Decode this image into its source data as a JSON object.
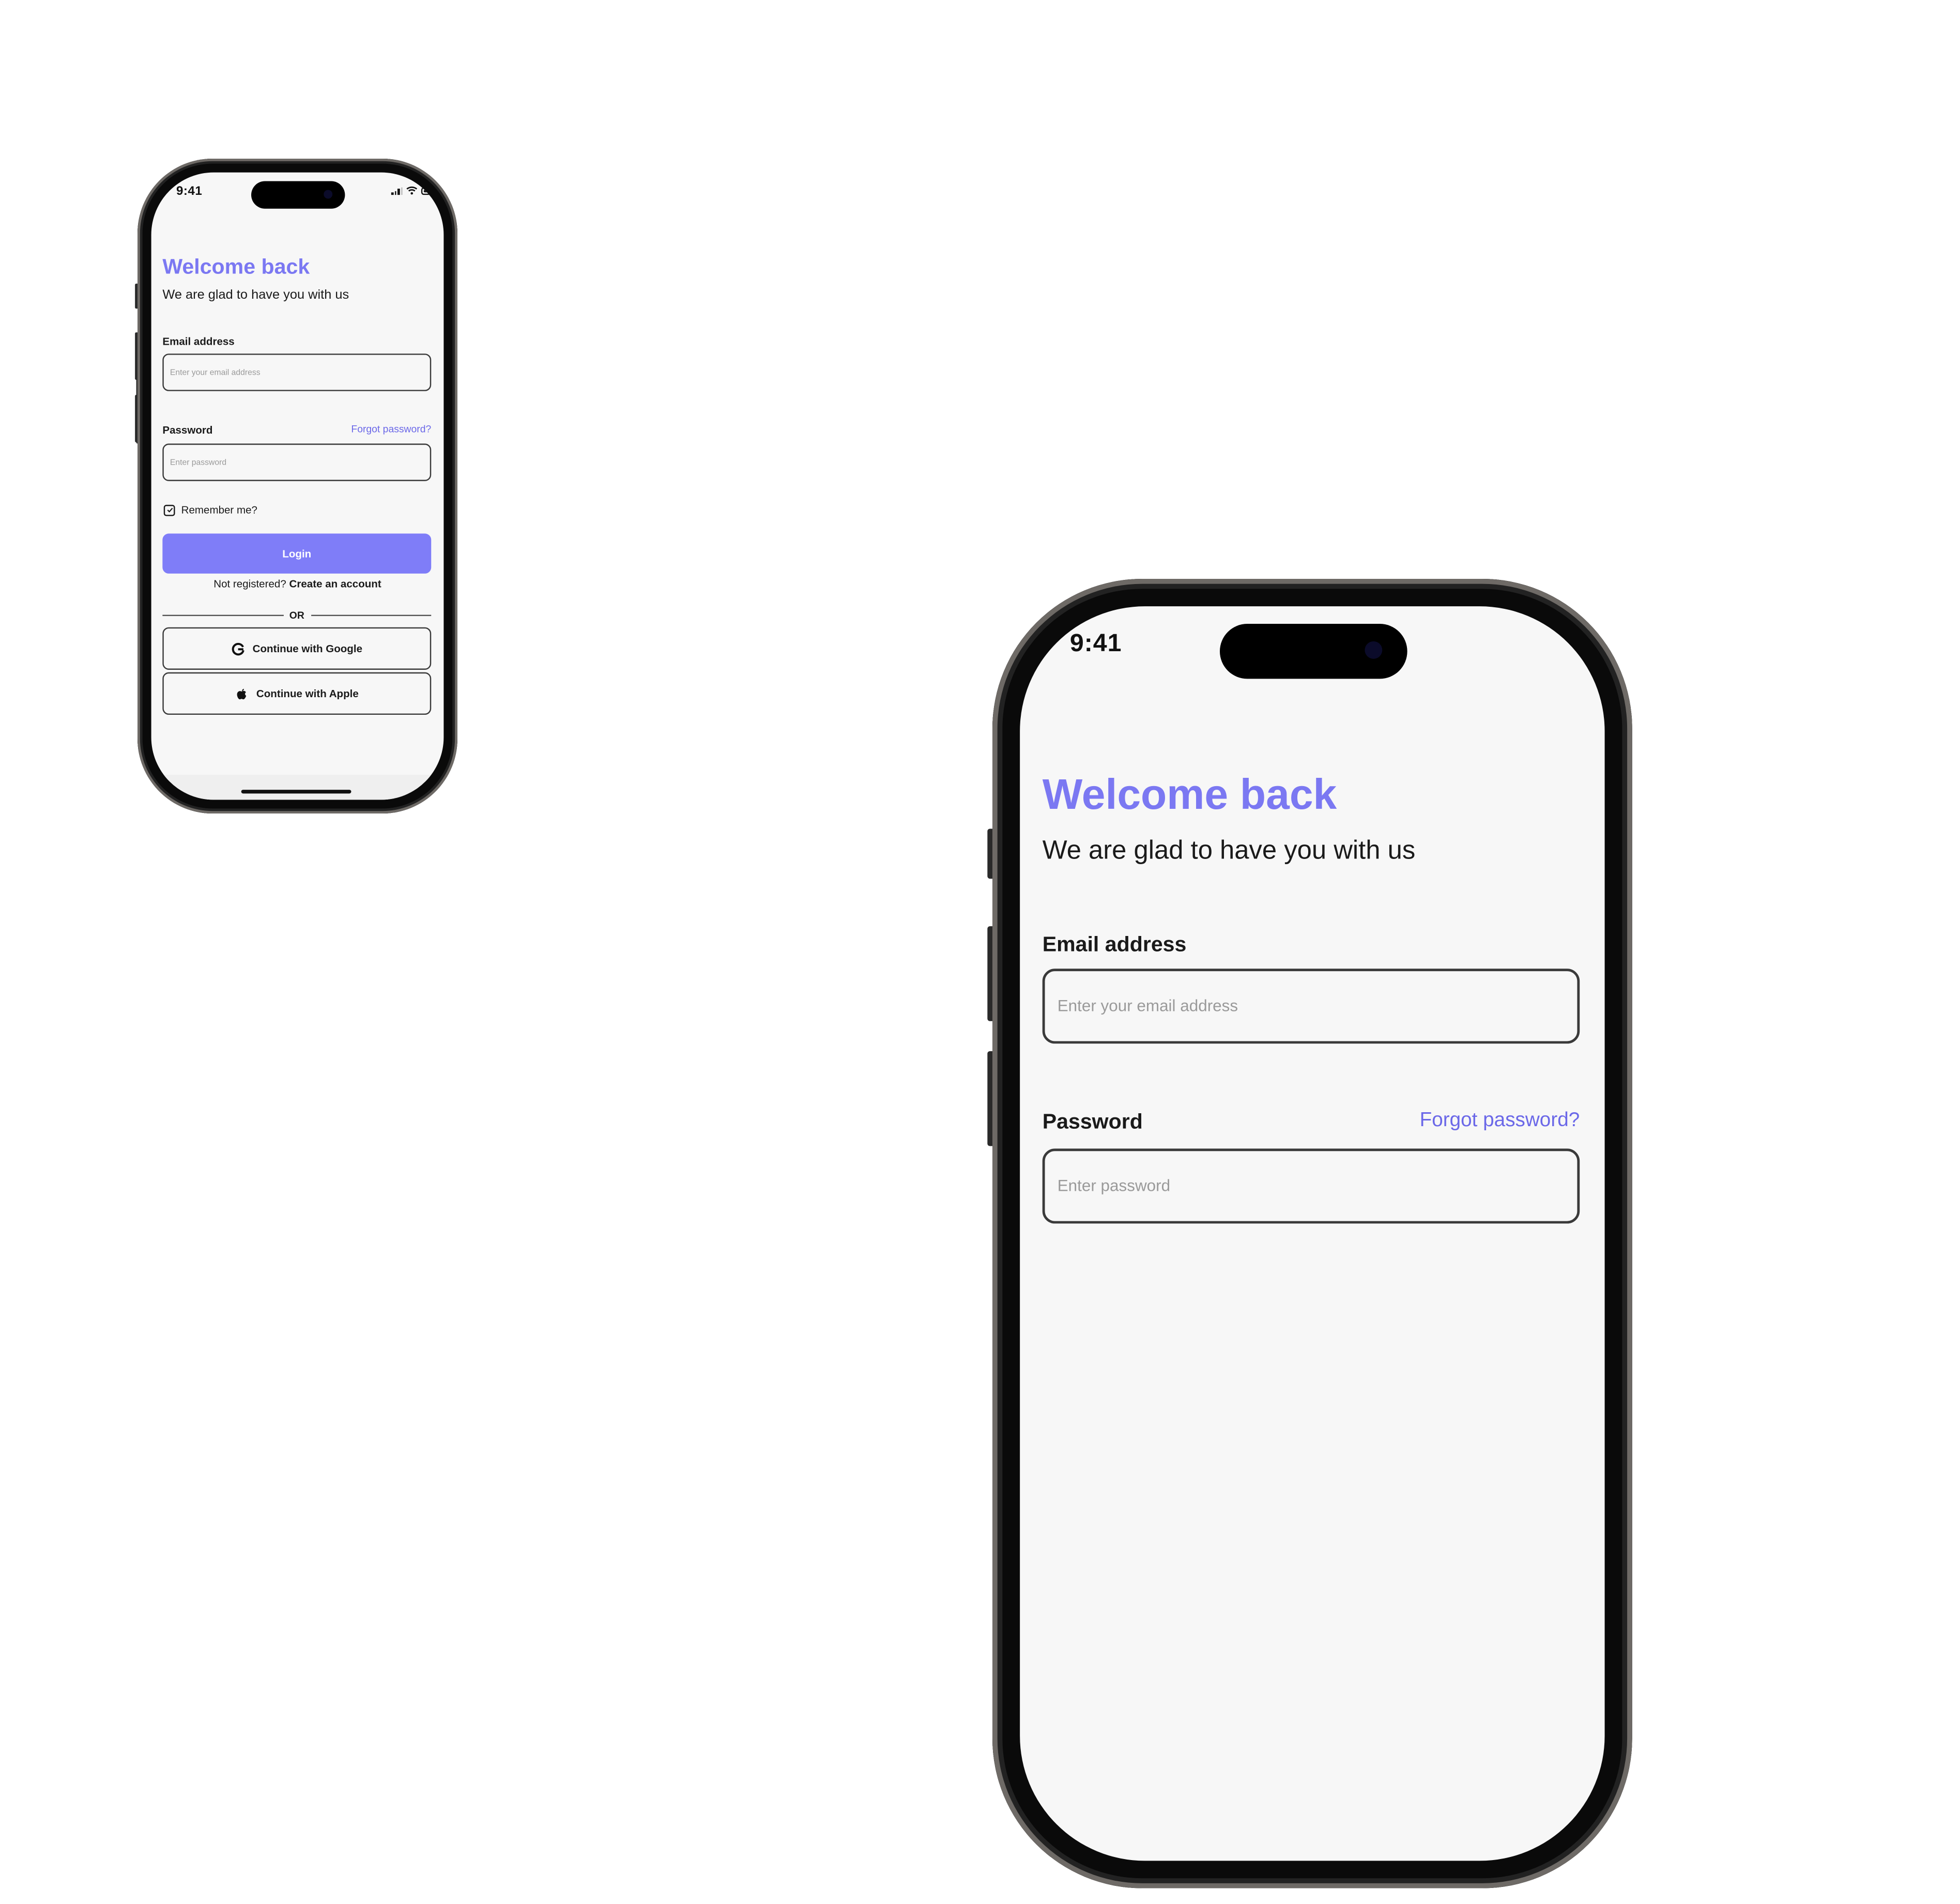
{
  "status_bar": {
    "time": "9:41"
  },
  "header": {
    "title": "Welcome back",
    "subtitle": "We are glad to have you with us"
  },
  "form": {
    "email_label": "Email address",
    "email_placeholder": "Enter your email address",
    "email_value": "",
    "password_label": "Password",
    "forgot_password": "Forgot password?",
    "password_placeholder": "Enter password",
    "password_value": "",
    "remember_label": "Remember me?",
    "remember_checked": true
  },
  "actions": {
    "login_label": "Login",
    "register_prompt": "Not registered?",
    "register_link": "Create an account",
    "divider_text": "OR",
    "google_label": "Continue with Google",
    "apple_label": "Continue with Apple"
  },
  "icons": {
    "signal": "cellular-signal-icon",
    "wifi": "wifi-icon",
    "battery": "battery-icon",
    "checkbox": "checkmark-icon",
    "google": "google-logo-icon",
    "apple": "apple-logo-icon"
  },
  "colors": {
    "accent": "#7b78f2",
    "button": "#7f7df8",
    "link": "#6b68e8",
    "screen_bg": "#f7f7f7",
    "text": "#1a1a1a"
  }
}
